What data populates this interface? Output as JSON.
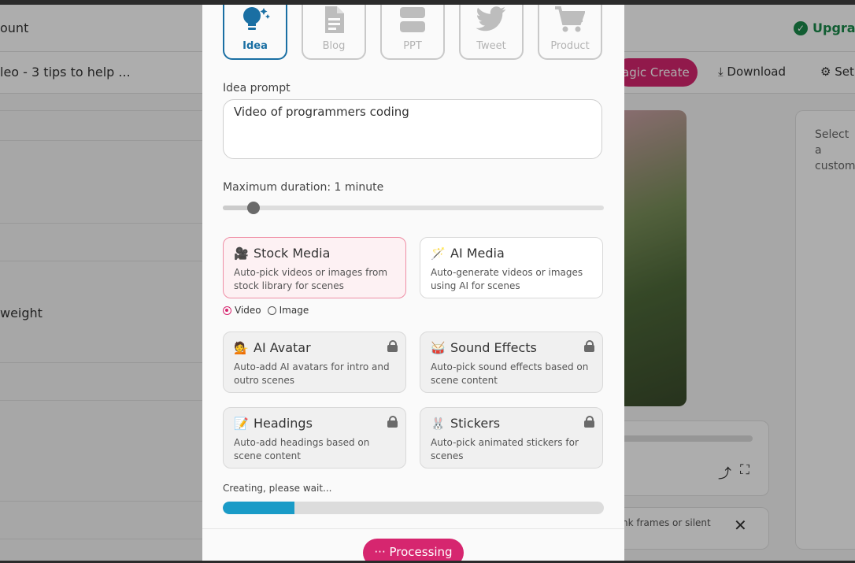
{
  "background": {
    "account_label": "ount",
    "upgrade_label": "Upgrac",
    "video_title": "leo - 3 tips to help ...",
    "magic_create_label": "agic Create",
    "download_label": "Download",
    "settings_label": "Set",
    "weight_label": "weight",
    "right_panel_text": "Select a custom",
    "note_text": "nk frames or silent"
  },
  "tabs": [
    {
      "label": "Idea",
      "icon": "lightbulb-icon",
      "active": true
    },
    {
      "label": "Blog",
      "icon": "document-icon",
      "active": false
    },
    {
      "label": "PPT",
      "icon": "slides-icon",
      "active": false
    },
    {
      "label": "Tweet",
      "icon": "twitter-icon",
      "active": false
    },
    {
      "label": "Product",
      "icon": "cart-icon",
      "active": false
    }
  ],
  "idea_prompt": {
    "label": "Idea prompt",
    "value": "Video of programmers coding"
  },
  "duration": {
    "label": "Maximum duration: 1 minute",
    "value_fraction": 0.08
  },
  "cards": [
    {
      "id": "stock-media",
      "emoji": "🎥",
      "title": "Stock Media",
      "desc": "Auto-pick videos or images from stock library for scenes",
      "selected": true,
      "locked": false
    },
    {
      "id": "ai-media",
      "emoji": "🪄",
      "title": "AI Media",
      "desc": "Auto-generate videos or images using AI for scenes",
      "selected": false,
      "locked": false
    },
    {
      "id": "ai-avatar",
      "emoji": "💁",
      "title": "AI Avatar",
      "desc": "Auto-add AI avatars for intro and outro scenes",
      "selected": false,
      "locked": true
    },
    {
      "id": "sound-effects",
      "emoji": "🥁",
      "title": "Sound Effects",
      "desc": "Auto-pick sound effects based on scene content",
      "selected": false,
      "locked": true
    },
    {
      "id": "headings",
      "emoji": "📝",
      "title": "Headings",
      "desc": "Auto-add headings based on scene content",
      "selected": false,
      "locked": true
    },
    {
      "id": "stickers",
      "emoji": "🐰",
      "title": "Stickers",
      "desc": "Auto-pick animated stickers for scenes",
      "selected": false,
      "locked": true
    }
  ],
  "media_type": {
    "options": [
      "Video",
      "Image"
    ],
    "selected": "Video"
  },
  "status": {
    "text": "Creating, please wait...",
    "progress_fraction": 0.187
  },
  "processing_button": {
    "label": "··· Processing"
  },
  "colors": {
    "accent_pink": "#d6266f",
    "active_blue": "#1a6fa3",
    "progress_blue": "#1a9bc7"
  }
}
